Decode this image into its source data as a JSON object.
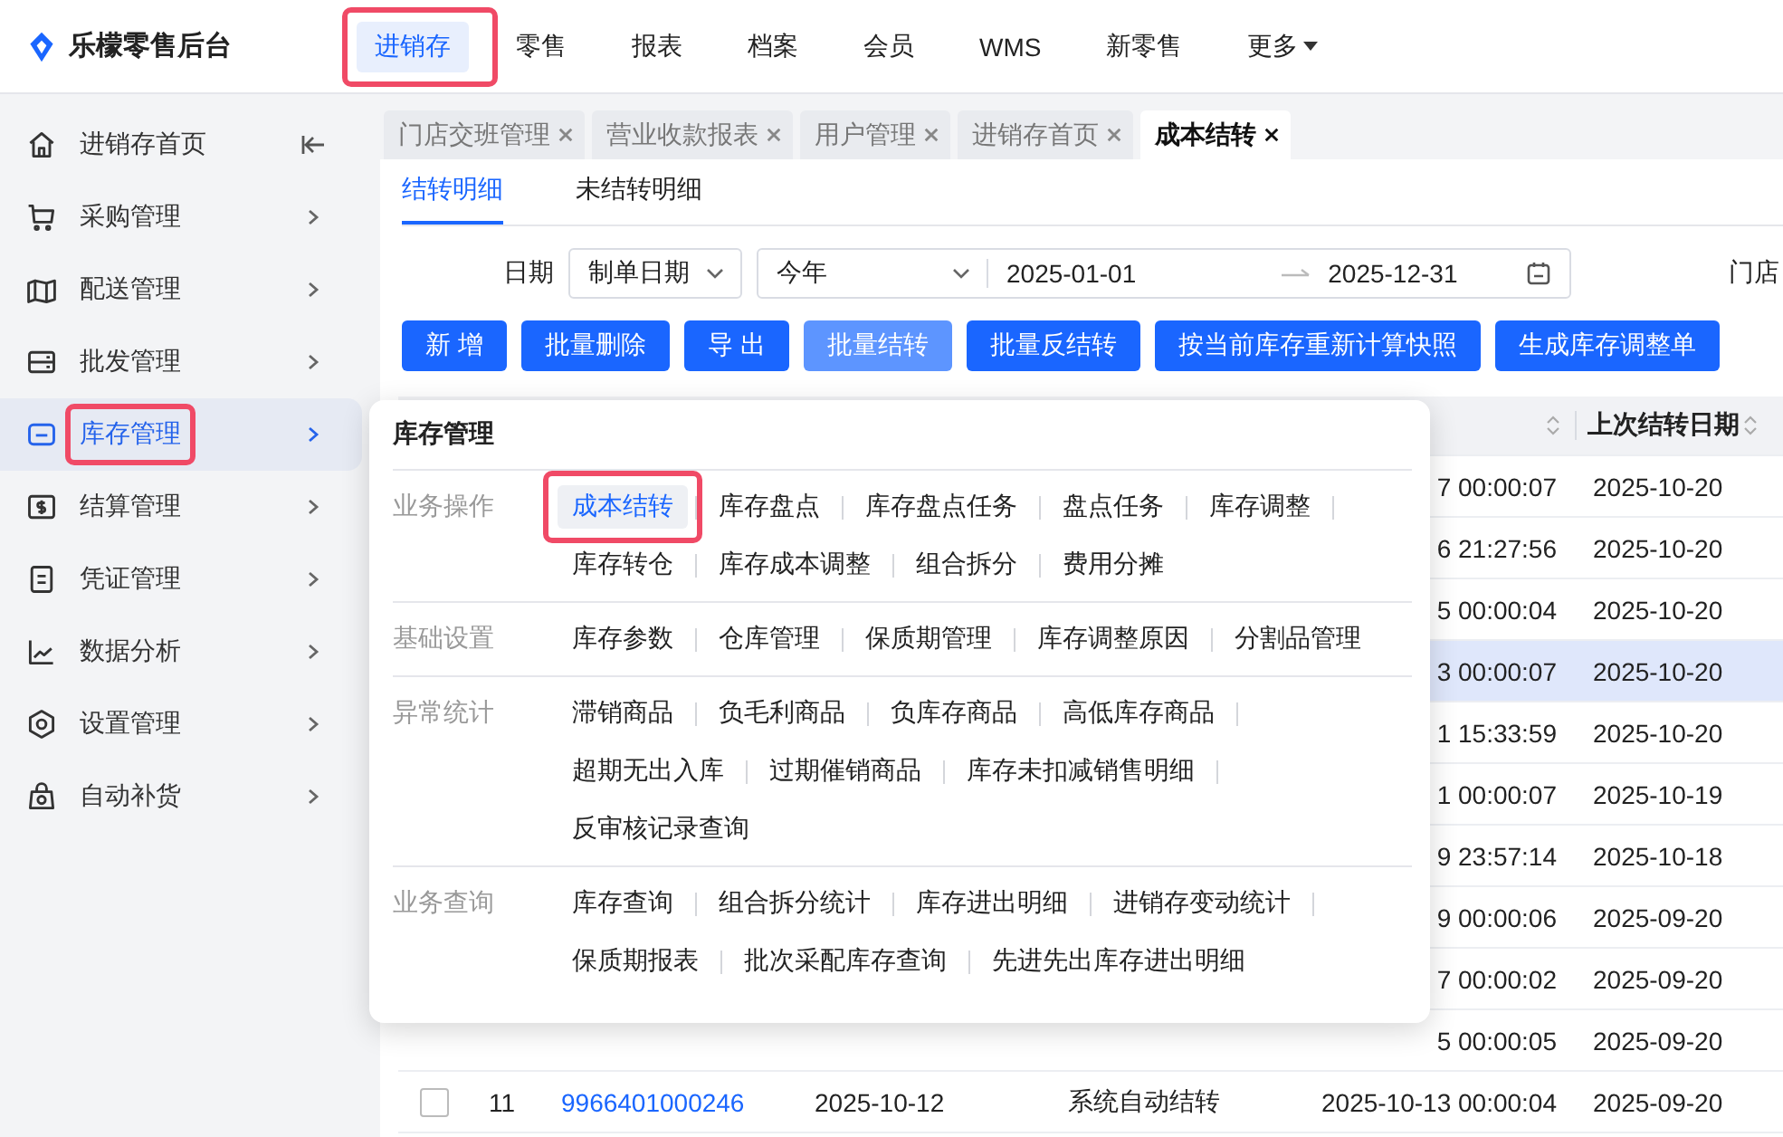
{
  "app": {
    "title": "乐檬零售后台"
  },
  "top_nav": [
    {
      "label": "进销存",
      "selected": true,
      "annotated": true
    },
    {
      "label": "零售",
      "selected": false,
      "annotated": false
    },
    {
      "label": "报表",
      "selected": false,
      "annotated": false
    },
    {
      "label": "档案",
      "selected": false,
      "annotated": false
    },
    {
      "label": "会员",
      "selected": false,
      "annotated": false
    },
    {
      "label": "WMS",
      "selected": false,
      "annotated": false
    },
    {
      "label": "新零售",
      "selected": false,
      "annotated": false
    },
    {
      "label": "更多",
      "selected": false,
      "annotated": false,
      "dropdown": true
    }
  ],
  "sidebar": {
    "items": [
      {
        "label": "进销存首页",
        "selected": false,
        "annotated": false,
        "kind": "home"
      },
      {
        "label": "采购管理",
        "selected": false,
        "annotated": false,
        "kind": "group"
      },
      {
        "label": "配送管理",
        "selected": false,
        "annotated": false,
        "kind": "group"
      },
      {
        "label": "批发管理",
        "selected": false,
        "annotated": false,
        "kind": "group"
      },
      {
        "label": "库存管理",
        "selected": true,
        "annotated": true,
        "kind": "group"
      },
      {
        "label": "结算管理",
        "selected": false,
        "annotated": false,
        "kind": "group"
      },
      {
        "label": "凭证管理",
        "selected": false,
        "annotated": false,
        "kind": "group"
      },
      {
        "label": "数据分析",
        "selected": false,
        "annotated": false,
        "kind": "group"
      },
      {
        "label": "设置管理",
        "selected": false,
        "annotated": false,
        "kind": "group"
      },
      {
        "label": "自动补货",
        "selected": false,
        "annotated": false,
        "kind": "group"
      }
    ]
  },
  "page_tabs": [
    {
      "label": "门店交班管理",
      "selected": false
    },
    {
      "label": "营业收款报表",
      "selected": false
    },
    {
      "label": "用户管理",
      "selected": false
    },
    {
      "label": "进销存首页",
      "selected": false
    },
    {
      "label": "成本结转",
      "selected": true
    }
  ],
  "sub_tabs": [
    {
      "label": "结转明细",
      "selected": true
    },
    {
      "label": "未结转明细",
      "selected": false
    }
  ],
  "filter": {
    "label": "日期",
    "date_type": "制单日期",
    "range_preset": "今年",
    "start": "2025-01-01",
    "end": "2025-12-31",
    "next_label": "门店"
  },
  "buttons": [
    {
      "label": "新 增",
      "disabled": false
    },
    {
      "label": "批量删除",
      "disabled": false
    },
    {
      "label": "导 出",
      "disabled": false
    },
    {
      "label": "批量结转",
      "disabled": true
    },
    {
      "label": "批量反结转",
      "disabled": false
    },
    {
      "label": "按当前库存重新计算快照",
      "disabled": false
    },
    {
      "label": "生成库存调整单",
      "disabled": false
    }
  ],
  "table": {
    "header": {
      "column_7": "上次结转日期"
    },
    "rows": [
      {
        "kind": "partial",
        "highlighted": false,
        "column_6": "7 00:00:07",
        "column_7": "2025-10-20"
      },
      {
        "kind": "partial",
        "highlighted": false,
        "column_6": "6 21:27:56",
        "column_7": "2025-10-20"
      },
      {
        "kind": "partial",
        "highlighted": false,
        "column_6": "5 00:00:04",
        "column_7": "2025-10-20"
      },
      {
        "kind": "partial",
        "highlighted": true,
        "column_6": "3 00:00:07",
        "column_7": "2025-10-20"
      },
      {
        "kind": "partial",
        "highlighted": false,
        "column_6": "1 15:33:59",
        "column_7": "2025-10-20"
      },
      {
        "kind": "partial",
        "highlighted": false,
        "column_6": "1 00:00:07",
        "column_7": "2025-10-19"
      },
      {
        "kind": "partial",
        "highlighted": false,
        "column_6": "9 23:57:14",
        "column_7": "2025-10-18"
      },
      {
        "kind": "partial",
        "highlighted": false,
        "column_6": "9 00:00:06",
        "column_7": "2025-09-20"
      },
      {
        "kind": "partial",
        "highlighted": false,
        "column_6": "7 00:00:02",
        "column_7": "2025-09-20"
      },
      {
        "kind": "partial",
        "highlighted": false,
        "column_6": "5 00:00:05",
        "column_7": "2025-09-20"
      },
      {
        "kind": "full",
        "highlighted": false,
        "checked": false,
        "column_2": "11",
        "column_3": "9966401000246",
        "column_4": "2025-10-12",
        "column_5": "系统自动结转",
        "column_6": "2025-10-13 00:00:04",
        "column_7": "2025-09-20"
      }
    ]
  },
  "popup": {
    "title": "库存管理",
    "sections": [
      {
        "label": "业务操作",
        "lines": [
          [
            {
              "label": "成本结转",
              "selected": true,
              "annotated": true
            },
            {
              "label": "库存盘点",
              "selected": false,
              "annotated": false
            },
            {
              "label": "库存盘点任务",
              "selected": false,
              "annotated": false
            },
            {
              "label": "盘点任务",
              "selected": false,
              "annotated": false
            },
            {
              "label": "库存调整",
              "selected": false,
              "annotated": false
            }
          ],
          [
            {
              "label": "库存转仓",
              "selected": false,
              "annotated": false
            },
            {
              "label": "库存成本调整",
              "selected": false,
              "annotated": false
            },
            {
              "label": "组合拆分",
              "selected": false,
              "annotated": false
            },
            {
              "label": "费用分摊",
              "selected": false,
              "annotated": false
            }
          ]
        ]
      },
      {
        "label": "基础设置",
        "lines": [
          [
            {
              "label": "库存参数",
              "selected": false,
              "annotated": false
            },
            {
              "label": "仓库管理",
              "selected": false,
              "annotated": false
            },
            {
              "label": "保质期管理",
              "selected": false,
              "annotated": false
            },
            {
              "label": "库存调整原因",
              "selected": false,
              "annotated": false
            },
            {
              "label": "分割品管理",
              "selected": false,
              "annotated": false
            }
          ]
        ]
      },
      {
        "label": "异常统计",
        "lines": [
          [
            {
              "label": "滞销商品",
              "selected": false,
              "annotated": false
            },
            {
              "label": "负毛利商品",
              "selected": false,
              "annotated": false
            },
            {
              "label": "负库存商品",
              "selected": false,
              "annotated": false
            },
            {
              "label": "高低库存商品",
              "selected": false,
              "annotated": false
            }
          ],
          [
            {
              "label": "超期无出入库",
              "selected": false,
              "annotated": false
            },
            {
              "label": "过期催销商品",
              "selected": false,
              "annotated": false
            },
            {
              "label": "库存未扣减销售明细",
              "selected": false,
              "annotated": false
            }
          ],
          [
            {
              "label": "反审核记录查询",
              "selected": false,
              "annotated": false
            }
          ]
        ]
      },
      {
        "label": "业务查询",
        "lines": [
          [
            {
              "label": "库存查询",
              "selected": false,
              "annotated": false
            },
            {
              "label": "组合拆分统计",
              "selected": false,
              "annotated": false
            },
            {
              "label": "库存进出明细",
              "selected": false,
              "annotated": false
            },
            {
              "label": "进销存变动统计",
              "selected": false,
              "annotated": false
            }
          ],
          [
            {
              "label": "保质期报表",
              "selected": false,
              "annotated": false
            },
            {
              "label": "批次采配库存查询",
              "selected": false,
              "annotated": false
            },
            {
              "label": "先进先出库存进出明细",
              "selected": false,
              "annotated": false
            }
          ]
        ]
      }
    ]
  }
}
